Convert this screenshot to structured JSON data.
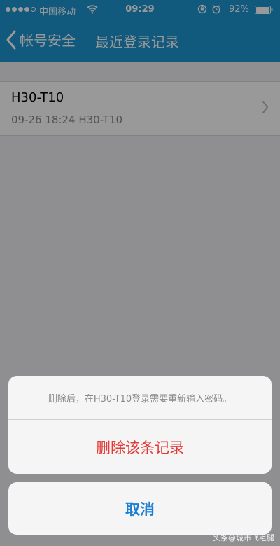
{
  "status_bar": {
    "carrier": "中国移动",
    "time": "09:29",
    "battery": "92%",
    "signal_icon": "signal-dots-icon",
    "wifi_icon": "wifi-icon",
    "lock_icon": "rotation-lock-icon",
    "alarm_icon": "alarm-icon",
    "battery_icon": "battery-icon"
  },
  "nav": {
    "back_label": "帐号安全",
    "title": "最近登录记录",
    "back_icon": "chevron-left-icon",
    "bar_color": "#1d96d2"
  },
  "records": [
    {
      "device": "H30-T10",
      "detail": "09-26 18:24  H30-T10",
      "chevron_icon": "chevron-right-icon"
    }
  ],
  "action_sheet": {
    "message": "删除后，在H30-T10登录需要重新输入密码。",
    "delete_label": "删除该条记录",
    "cancel_label": "取消",
    "delete_color": "#e53935",
    "cancel_color": "#1a7ed2"
  },
  "watermark": "头条@城市飞毛腿"
}
